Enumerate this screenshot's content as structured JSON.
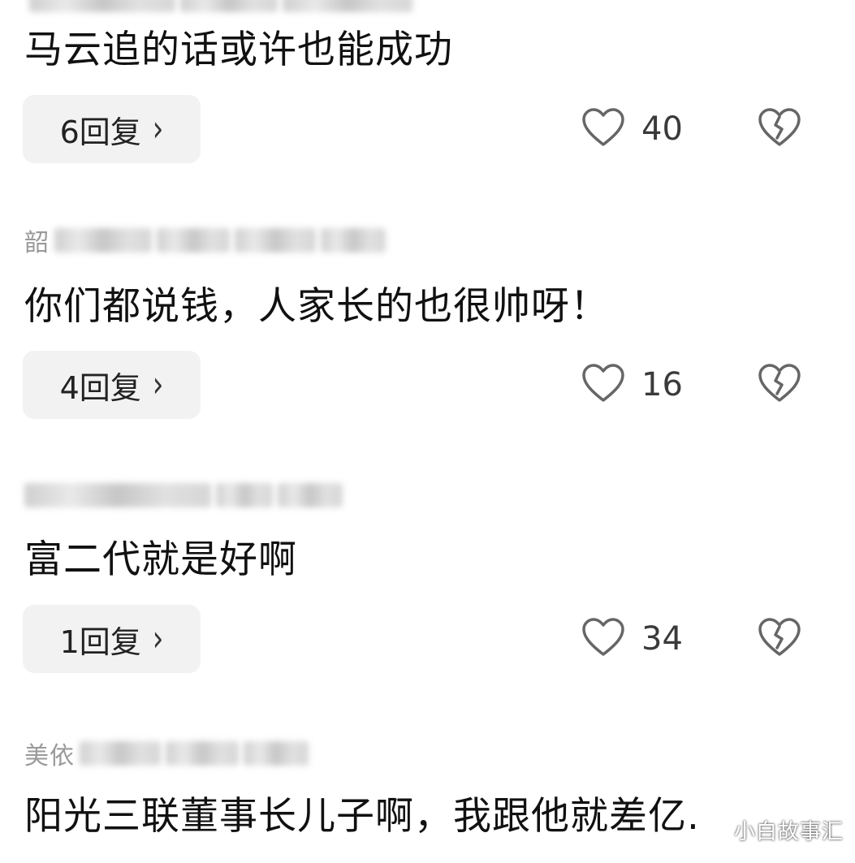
{
  "comments": [
    {
      "username_visible": "",
      "text": "马云追的话或许也能成功",
      "replies_label": "6回复",
      "likes": "40"
    },
    {
      "username_visible": "韶",
      "text": "你们都说钱，人家长的也很帅呀！",
      "replies_label": "4回复",
      "likes": "16"
    },
    {
      "username_visible": "",
      "text": "富二代就是好啊",
      "replies_label": "1回复",
      "likes": "34"
    },
    {
      "username_visible": "美依",
      "text": "阳光三联董事长儿子啊，我跟他就差亿.",
      "replies_label": "",
      "likes": ""
    }
  ],
  "icons": {
    "like": "heart-outline-icon",
    "dislike": "broken-heart-icon",
    "chevron": "chevron-right-icon"
  },
  "watermark": "小白故事汇",
  "colors": {
    "reply_bg": "#f2f2f2",
    "text": "#111111",
    "muted": "#9a9a9a"
  }
}
